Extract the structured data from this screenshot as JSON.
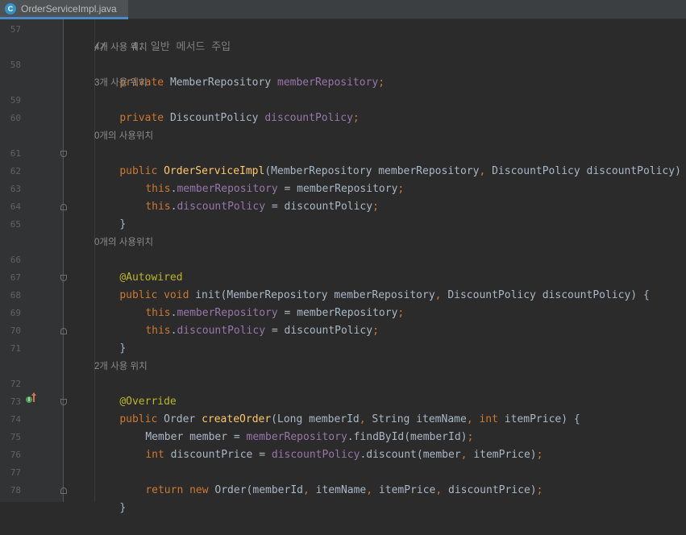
{
  "tab": {
    "file_name": "OrderServiceImpl.java",
    "file_icon_letter": "C"
  },
  "line_numbers": [
    "57",
    "58",
    "59",
    "60",
    "61",
    "62",
    "63",
    "64",
    "65",
    "66",
    "67",
    "68",
    "69",
    "70",
    "71",
    "72",
    "73",
    "74",
    "75",
    "76",
    "77",
    "78"
  ],
  "hints": {
    "h58": "4개 사용 위치",
    "h59": "3개 사용 위치",
    "h61": "0개의 사용위치",
    "h66": "0개의 사용위치",
    "h72": "2개 사용 위치"
  },
  "code": {
    "l57": {
      "comment": "//    4. 일반 메서드 주입"
    },
    "l58": {
      "kw": "private ",
      "type": "MemberRepository ",
      "field": "memberRepository",
      "semi": ";"
    },
    "l59": {
      "kw": "private ",
      "type": "DiscountPolicy ",
      "field": "discountPolicy",
      "semi": ";"
    },
    "l61": {
      "kw": "public ",
      "name": "OrderServiceImpl",
      "p1": "(MemberRepository memberRepository",
      "comma": ", ",
      "p2": "DiscountPolicy discountPolicy) {"
    },
    "l62": {
      "kw": "this",
      "dot": ".",
      "field": "memberRepository",
      "rest": " = memberRepository",
      "semi": ";"
    },
    "l63": {
      "kw": "this",
      "dot": ".",
      "field": "discountPolicy",
      "rest": " = discountPolicy",
      "semi": ";"
    },
    "l64": {
      "text": "}"
    },
    "l66": {
      "ann": "@Autowired"
    },
    "l67": {
      "kw": "public void ",
      "name": "init",
      "p1": "(MemberRepository memberRepository",
      "comma": ", ",
      "p2": "DiscountPolicy discountPolicy) {"
    },
    "l68": {
      "kw": "this",
      "dot": ".",
      "field": "memberRepository",
      "rest": " = memberRepository",
      "semi": ";"
    },
    "l69": {
      "kw": "this",
      "dot": ".",
      "field": "discountPolicy",
      "rest": " = discountPolicy",
      "semi": ";"
    },
    "l70": {
      "text": "}"
    },
    "l72": {
      "ann": "@Override"
    },
    "l73": {
      "kw": "public ",
      "type": "Order ",
      "name": "createOrder",
      "a": "(Long memberId",
      "c1": ", ",
      "b": "String itemName",
      "c2": ", ",
      "kw2": "int ",
      "c": "itemPrice) {"
    },
    "l74": {
      "a": "Member member = ",
      "field": "memberRepository",
      "b": ".findById(memberId)",
      "semi": ";"
    },
    "l75": {
      "kw": "int ",
      "a": "discountPrice = ",
      "field": "discountPolicy",
      "b": ".discount(member",
      "c1": ", ",
      "c": "itemPrice)",
      "semi": ";"
    },
    "l77": {
      "kw": "return new ",
      "a": "Order(memberId",
      "c1": ", ",
      "b": "itemName",
      "c2": ", ",
      "c": "itemPrice",
      "c3": ", ",
      "d": "discountPrice)",
      "semi": ";"
    },
    "l78": {
      "text": "}"
    }
  },
  "colors": {
    "background": "#2b2b2b",
    "gutter": "#313335",
    "keyword": "#cc7832",
    "field": "#9876aa",
    "annotation": "#bbb529",
    "method": "#ffc66d",
    "comment": "#808080",
    "text": "#a9b7c6",
    "tab_accent": "#4a88c7"
  }
}
